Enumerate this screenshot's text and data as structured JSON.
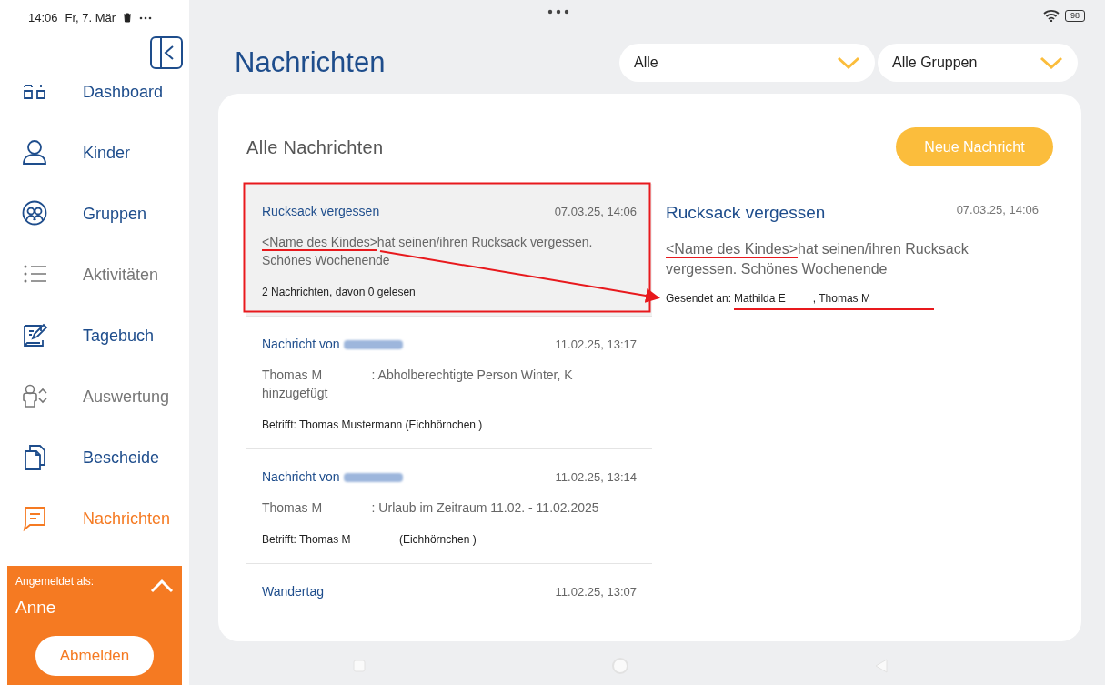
{
  "status_bar": {
    "time": "14:06",
    "date": "Fr, 7. Mär",
    "battery": "98"
  },
  "sidebar": {
    "items": [
      {
        "label": "Dashboard",
        "selected": false,
        "disabled": false
      },
      {
        "label": "Kinder",
        "selected": false,
        "disabled": false
      },
      {
        "label": "Gruppen",
        "selected": false,
        "disabled": false
      },
      {
        "label": "Aktivitäten",
        "selected": false,
        "disabled": true
      },
      {
        "label": "Tagebuch",
        "selected": false,
        "disabled": false
      },
      {
        "label": "Auswertung",
        "selected": false,
        "disabled": true
      },
      {
        "label": "Bescheide",
        "selected": false,
        "disabled": false
      },
      {
        "label": "Nachrichten",
        "selected": true,
        "disabled": false
      }
    ],
    "user": {
      "caption": "Angemeldet als:",
      "name": "Anne",
      "logout": "Abmelden"
    }
  },
  "header": {
    "title": "Nachrichten",
    "filters": [
      {
        "value": "Alle"
      },
      {
        "value": "Alle Gruppen"
      }
    ]
  },
  "messages": {
    "heading": "Alle Nachrichten",
    "new_button": "Neue Nachricht",
    "items": [
      {
        "title": "Rucksack vergessen",
        "sender_hidden": false,
        "date": "07.03.25, 14:06",
        "body_marked": "<Name des Kindes>",
        "body": "hat seinen/ihren Rucksack vergessen. Schönes Wochenende",
        "footer": "2 Nachrichten, davon 0 gelesen",
        "selected": true
      },
      {
        "title": "Nachricht von",
        "sender_hidden": true,
        "date": "11.02.25, 13:17",
        "body": "Thomas M              : Abholberechtigte Person Winter, K hinzugefügt",
        "footer": "Betrifft: Thomas Mustermann (Eichhörnchen )",
        "selected": false
      },
      {
        "title": "Nachricht von",
        "sender_hidden": true,
        "date": "11.02.25, 13:14",
        "body": "Thomas M              : Urlaub im Zeitraum 11.02. - 11.02.2025",
        "footer": "Betrifft: Thomas M                (Eichhörnchen )",
        "selected": false
      },
      {
        "title": "Wandertag",
        "sender_hidden": false,
        "date": "11.02.25, 13:07",
        "selected": false
      }
    ]
  },
  "detail": {
    "title": "Rucksack vergessen",
    "date": "07.03.25, 14:06",
    "body_marked": "<Name des Kindes>",
    "body": "hat seinen/ihren Rucksack vergessen. Schönes Wochenende",
    "recipients_label": "Gesendet an:",
    "recipients": "Mathilda E         , Thomas M"
  }
}
